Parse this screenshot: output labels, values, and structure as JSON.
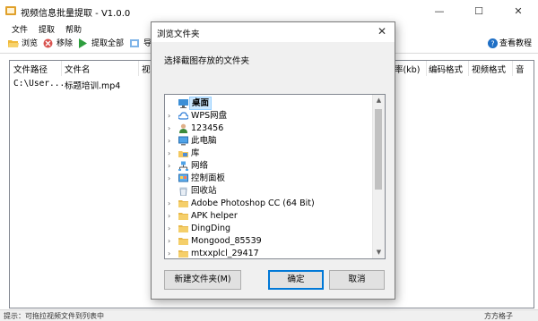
{
  "window": {
    "title": "视频信息批量提取 - V1.0.0",
    "controls": {
      "minimize": "—",
      "maximize": "☐",
      "close": "✕"
    }
  },
  "menu": [
    "文件",
    "提取",
    "帮助"
  ],
  "toolbar": {
    "browse": "浏览",
    "remove": "移除",
    "extract_all": "提取全部",
    "export": "导",
    "tutorial": "查看教程"
  },
  "table": {
    "headers": [
      "文件路径",
      "文件名",
      "视",
      "率(kb)",
      "编码格式",
      "视频格式",
      "音"
    ],
    "rows": [
      {
        "path": "C:\\User...",
        "name": "标题培训.mp4"
      }
    ]
  },
  "status": {
    "hint": "提示：可拖拉视频文件到列表中",
    "right": "方方格子"
  },
  "dialog": {
    "title": "浏览文件夹",
    "close": "✕",
    "prompt": "选择截图存放的文件夹",
    "tree": [
      {
        "label": "桌面",
        "icon": "desktop-icon",
        "selected": true,
        "expandable": false
      },
      {
        "label": "WPS网盘",
        "icon": "cloud-icon",
        "expandable": true
      },
      {
        "label": "123456",
        "icon": "user-icon",
        "expandable": true
      },
      {
        "label": "此电脑",
        "icon": "computer-icon",
        "expandable": true
      },
      {
        "label": "库",
        "icon": "library-icon",
        "expandable": true
      },
      {
        "label": "网络",
        "icon": "network-icon",
        "expandable": true
      },
      {
        "label": "控制面板",
        "icon": "control-panel-icon",
        "expandable": true
      },
      {
        "label": "回收站",
        "icon": "recycle-bin-icon",
        "expandable": false
      },
      {
        "label": "Adobe Photoshop CC (64 Bit)",
        "icon": "folder-icon",
        "expandable": true
      },
      {
        "label": "APK helper",
        "icon": "folder-icon",
        "expandable": true
      },
      {
        "label": "DingDing",
        "icon": "folder-icon",
        "expandable": true
      },
      {
        "label": "Mongood_85539",
        "icon": "folder-icon",
        "expandable": true
      },
      {
        "label": "mtxxplcl_29417",
        "icon": "folder-icon",
        "expandable": true
      }
    ],
    "buttons": {
      "new_folder": "新建文件夹(M)",
      "ok": "确定",
      "cancel": "取消"
    }
  },
  "colors": {
    "accent": "#0078d7",
    "folder": "#f3c860",
    "selection": "#cce8ff"
  }
}
